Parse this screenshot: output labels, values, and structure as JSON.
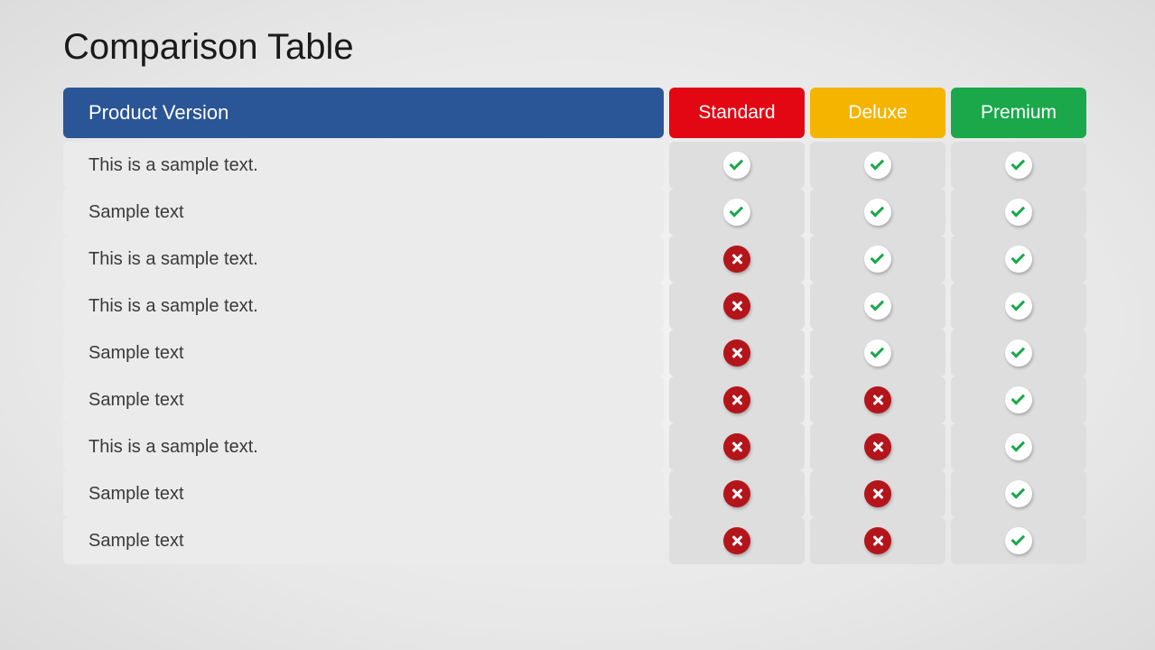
{
  "title": "Comparison Table",
  "chart_data": {
    "type": "table",
    "title": "Comparison Table",
    "header": {
      "feature_label": "Product Version",
      "plans": [
        "Standard",
        "Deluxe",
        "Premium"
      ]
    },
    "rows": [
      {
        "feature": "This is a sample text.",
        "values": [
          true,
          true,
          true
        ]
      },
      {
        "feature": "Sample text",
        "values": [
          true,
          true,
          true
        ]
      },
      {
        "feature": "This is a sample text.",
        "values": [
          false,
          true,
          true
        ]
      },
      {
        "feature": "This is a sample text.",
        "values": [
          false,
          true,
          true
        ]
      },
      {
        "feature": "Sample text",
        "values": [
          false,
          true,
          true
        ]
      },
      {
        "feature": "Sample text",
        "values": [
          false,
          false,
          true
        ]
      },
      {
        "feature": "This is a sample text.",
        "values": [
          false,
          false,
          true
        ]
      },
      {
        "feature": "Sample text",
        "values": [
          false,
          false,
          true
        ]
      },
      {
        "feature": "Sample text",
        "values": [
          false,
          false,
          true
        ]
      }
    ],
    "colors": {
      "feature_header": "#2a5596",
      "standard": "#e30613",
      "deluxe": "#f5b400",
      "premium": "#1aa84b",
      "yes_tick": "#1aa84b",
      "no_bg": "#b3151b"
    }
  }
}
